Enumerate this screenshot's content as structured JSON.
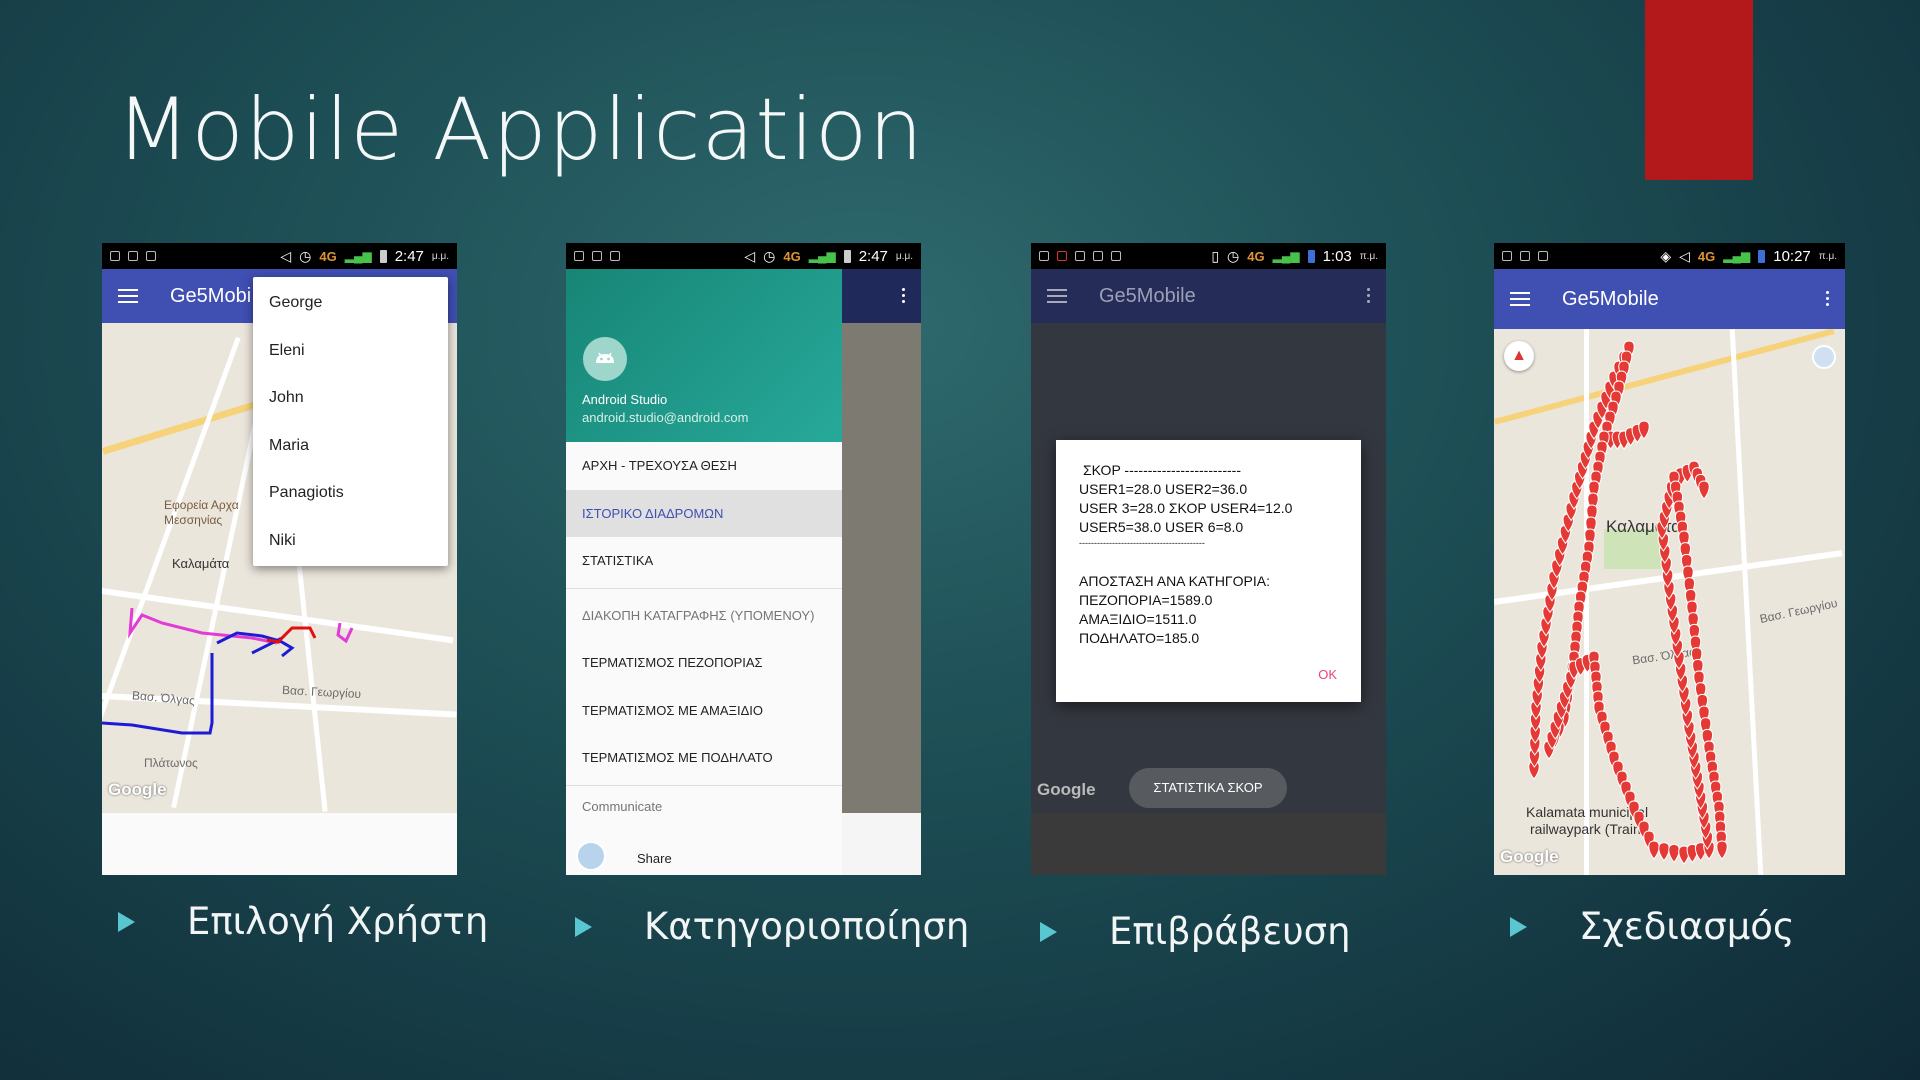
{
  "slide": {
    "title": "Mobile Application"
  },
  "captions": [
    "Επιλογή Χρήστη",
    "Κατηγοριοποίηση",
    "Επιβράβευση",
    "Σχεδιασμός"
  ],
  "phones": {
    "p1": {
      "status_time": "2:47",
      "status_pm": "μ.μ.",
      "app_title": "Ge5Mobi",
      "users": [
        "George",
        "Eleni",
        "John",
        "Maria",
        "Panagiotis",
        "Niki"
      ],
      "map_labels": [
        "Εφορεία Αρχα",
        "Μεσσηνίας",
        "Καλαμάτα",
        "Βασ. Όλγας",
        "Βασ. Γεωργίου",
        "Πλάτωνος"
      ],
      "google": "Google"
    },
    "p2": {
      "status_time": "2:47",
      "status_pm": "μ.μ.",
      "drawer_name": "Android Studio",
      "drawer_email": "android.studio@android.com",
      "menu": [
        "ΑΡΧΗ - ΤΡΕΧΟΥΣΑ ΘΕΣΗ",
        "ΙΣΤΟΡΙΚΟ ΔΙΑΔΡΟΜΩΝ",
        "ΣΤΑΤΙΣΤΙΚΑ"
      ],
      "menu2": [
        "ΔΙΑΚΟΠΗ ΚΑΤΑΓΡΑΦΗΣ (ΥΠΟΜΕΝΟΥ)",
        "ΤΕΡΜΑΤΙΣΜΟΣ ΠΕΖΟΠΟΡΙΑΣ",
        "ΤΕΡΜΑΤΙΣΜΟΣ ΜΕ ΑΜΑΞΙΔΙΟ",
        "ΤΕΡΜΑΤΙΣΜΟΣ ΜΕ ΠΟΔΗΛΑΤΟ"
      ],
      "section": "Communicate",
      "share": "Share"
    },
    "p3": {
      "status_time": "1:03",
      "status_pm": "π.μ.",
      "app_title": "Ge5Mobile",
      "dialog_lines": [
        "ΣΚΟΡ -------------------------",
        "USER1=28.0 USER2=36.0",
        "USER 3=28.0 ΣΚΟΡ USER4=12.0",
        "USER5=38.0 USER 6=8.0",
        "------------------------------------------",
        "ΑΠΟΣΤΑΣΗ ΑΝΑ ΚΑΤΗΓΟΡΙΑ:",
        "ΠΕΖΟΠΟΡΙΑ=1589.0",
        "ΑΜΑΞΙΔΙΟ=1511.0",
        "ΠΟΔΗΛΑΤΟ=185.0"
      ],
      "ok": "OK",
      "chip": "ΣΤΑΤΙΣΤΙΚΑ ΣΚΟΡ",
      "google": "Google"
    },
    "p4": {
      "status_time": "10:27",
      "status_pm": "π.μ.",
      "app_title": "Ge5Mobile",
      "map_labels": [
        "Καλαμάτα",
        "Kalamata municipal",
        "railwaypark (Train...",
        "Βασ. Όλγας",
        "Βασ. Γεωργίου"
      ],
      "google": "Google"
    }
  }
}
